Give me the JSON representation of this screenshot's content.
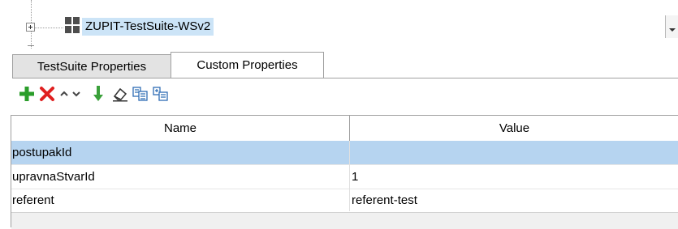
{
  "tree": {
    "node_label": "ZUPIT-TestSuite-WSv2",
    "node_icon": "test-suite-icon",
    "expander_icon": "plus-expand-icon",
    "selection_color": "#cce4f7"
  },
  "tabs": [
    {
      "label": "TestSuite Properties",
      "active": false
    },
    {
      "label": "Custom Properties",
      "active": true
    }
  ],
  "toolbar": {
    "icons": [
      {
        "name": "add-property-icon",
        "color": "#2a9d2a"
      },
      {
        "name": "remove-property-icon",
        "color": "#e02020"
      },
      {
        "name": "move-up-icon",
        "color": "#333333"
      },
      {
        "name": "move-down-icon",
        "color": "#333333"
      },
      {
        "name": "load-from-file-icon",
        "color": "#3aa03a"
      },
      {
        "name": "clear-values-icon",
        "color": "#333333"
      },
      {
        "name": "copy-properties-icon",
        "color": "#2f6db5"
      },
      {
        "name": "paste-properties-icon",
        "color": "#2f6db5"
      }
    ]
  },
  "table": {
    "columns": [
      "Name",
      "Value"
    ],
    "rows": [
      {
        "name": "postupakId",
        "value": "",
        "selected": true
      },
      {
        "name": "upravnaStvarId",
        "value": "1",
        "selected": false
      },
      {
        "name": "referent",
        "value": "referent-test",
        "selected": false
      }
    ],
    "selected_row_color": "#b6d4f0"
  }
}
